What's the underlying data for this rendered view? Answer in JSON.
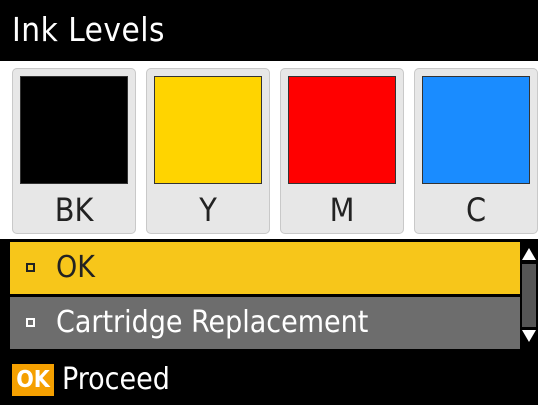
{
  "header": {
    "title": "Ink Levels"
  },
  "cartridges": [
    {
      "label": "BK",
      "color": "#000000"
    },
    {
      "label": "Y",
      "color": "#ffd400"
    },
    {
      "label": "M",
      "color": "#ff0000"
    },
    {
      "label": "C",
      "color": "#1a8cff"
    }
  ],
  "menu": {
    "items": [
      {
        "label": "OK",
        "selected": true
      },
      {
        "label": "Cartridge Replacement",
        "selected": false
      }
    ]
  },
  "footer": {
    "key": "OK",
    "action": "Proceed"
  }
}
